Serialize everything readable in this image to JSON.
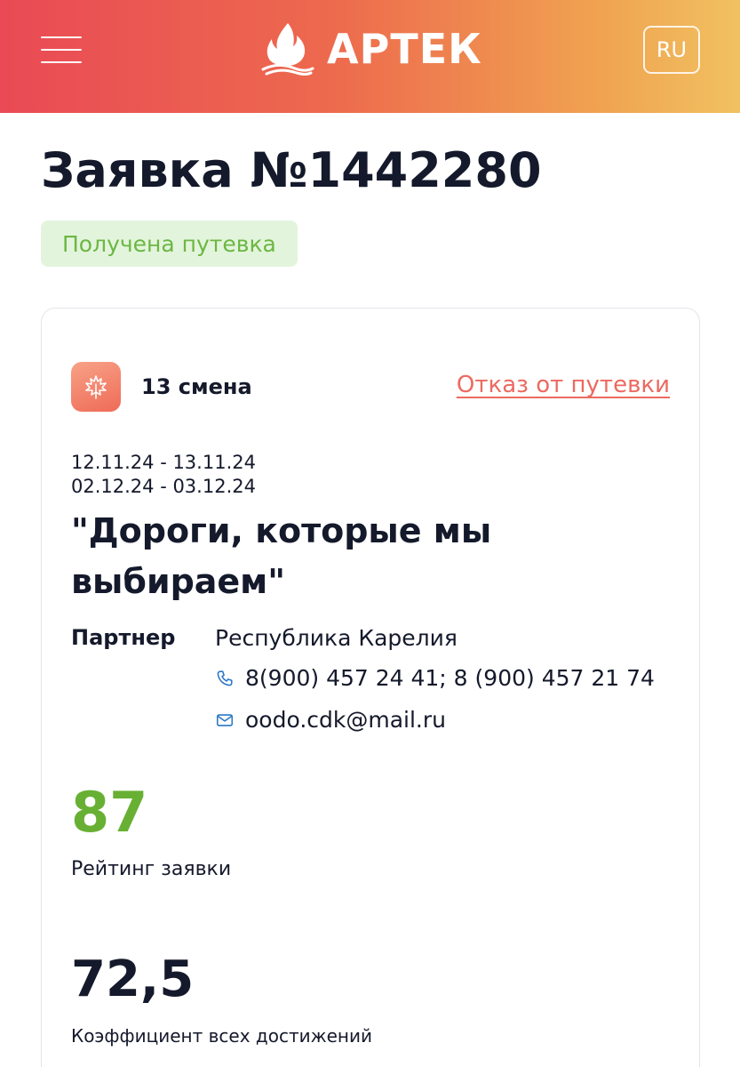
{
  "header": {
    "logo_text": "АРТЕК",
    "language": "RU",
    "background_gradient": [
      "#e94a55",
      "#f1c160"
    ]
  },
  "page": {
    "title": "Заявка №1442280",
    "status": "Получена путевка"
  },
  "card": {
    "shift": "13 смена",
    "refuse_link": "Отказ от путевки",
    "dates": [
      "12.11.24 - 13.11.24",
      "02.12.24 - 03.12.24"
    ],
    "program_title": "\"Дороги, которые мы выбираем\"",
    "partner": {
      "label": "Партнер",
      "name": "Республика Карелия",
      "phone": "8(900) 457 24 41; 8 (900) 457 21 74",
      "email": "oodo.cdk@mail.ru"
    },
    "rating": {
      "value": "87",
      "label": "Рейтинг заявки",
      "color": "#68b033"
    },
    "coefficient": {
      "value": "72,5",
      "label": "Коэффициент всех достижений"
    }
  },
  "colors": {
    "accent_link": "#ec6a60",
    "status_bg": "#e3f4dc",
    "status_text": "#6cb743",
    "text_primary": "#14192b"
  },
  "icons": [
    "menu-icon",
    "artek-flame-logo",
    "maple-leaf-icon",
    "phone-icon",
    "mail-icon"
  ]
}
